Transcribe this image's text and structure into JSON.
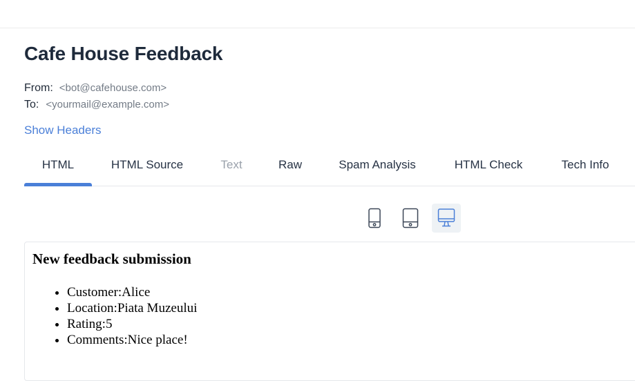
{
  "email": {
    "title": "Cafe House Feedback",
    "from_label": "From:",
    "from_value": "<bot@cafehouse.com>",
    "to_label": "To:",
    "to_value": "<yourmail@example.com>",
    "show_headers": "Show Headers"
  },
  "tabs": [
    {
      "label": "HTML",
      "state": "active"
    },
    {
      "label": "HTML Source",
      "state": "normal"
    },
    {
      "label": "Text",
      "state": "disabled"
    },
    {
      "label": "Raw",
      "state": "normal"
    },
    {
      "label": "Spam Analysis",
      "state": "normal"
    },
    {
      "label": "HTML Check",
      "state": "normal"
    },
    {
      "label": "Tech Info",
      "state": "normal"
    }
  ],
  "view_modes": [
    {
      "icon": "mobile-icon",
      "selected": false
    },
    {
      "icon": "tablet-icon",
      "selected": false
    },
    {
      "icon": "desktop-icon",
      "selected": true
    }
  ],
  "preview": {
    "heading": "New feedback submission",
    "items": [
      {
        "label": "Customer:",
        "value": "Alice"
      },
      {
        "label": "Location:",
        "value": "Piata Muzeului"
      },
      {
        "label": "Rating:",
        "value": "5"
      },
      {
        "label": "Comments:",
        "value": "Nice place!"
      }
    ]
  },
  "colors": {
    "accent": "#4a7fd8",
    "icon": "#3a4556",
    "icon_active": "#4a7fd8",
    "title": "#1e2a3b",
    "muted": "#737b86"
  }
}
